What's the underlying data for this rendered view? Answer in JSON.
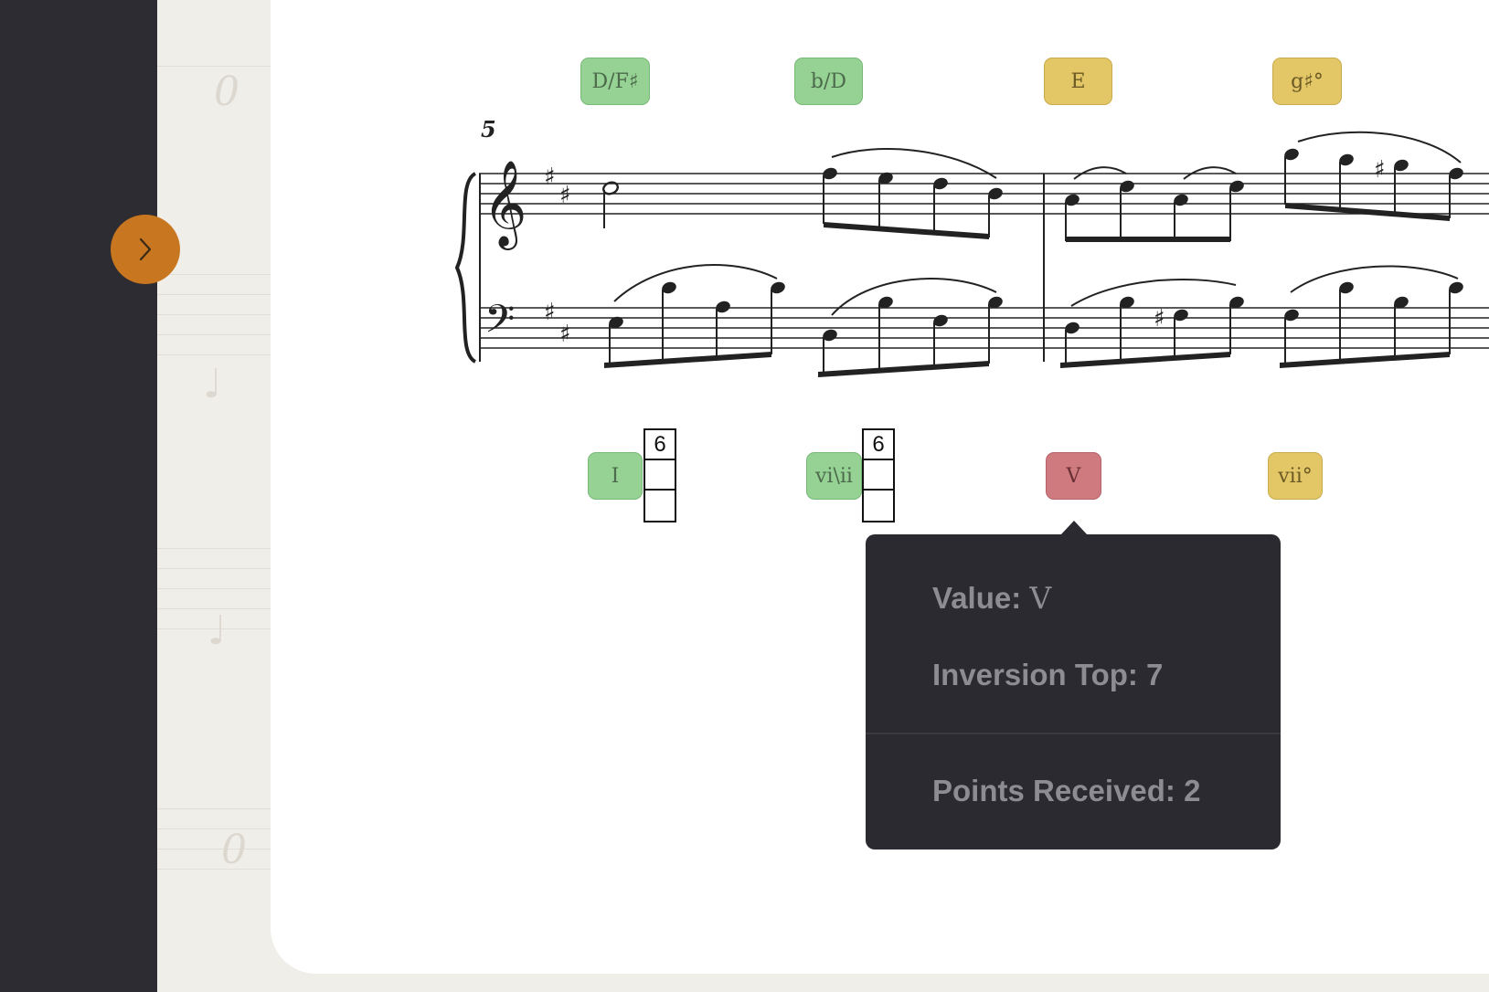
{
  "measure_number": "5",
  "chord_names": [
    {
      "label": "D/F♯",
      "status": "correct"
    },
    {
      "label": "b/D",
      "status": "correct"
    },
    {
      "label": "E",
      "status": "partial"
    },
    {
      "label": "g♯°",
      "status": "partial"
    }
  ],
  "roman_numerals": [
    {
      "label": "I",
      "status": "correct",
      "inversion": {
        "top": "6",
        "middle": "",
        "bottom": ""
      }
    },
    {
      "label": "vi\\ii",
      "status": "correct",
      "inversion": {
        "top": "6",
        "middle": "",
        "bottom": ""
      }
    },
    {
      "label": "V",
      "status": "incorrect"
    },
    {
      "label": "vii°",
      "status": "partial"
    }
  ],
  "tooltip": {
    "value_label": "Value:",
    "value": "V",
    "inversion_top": "Inversion Top: 7",
    "points_received": "Points Received: 2"
  },
  "colors": {
    "correct": "#95d293",
    "partial": "#e3c766",
    "incorrect": "#cf7a7f",
    "toggle": "#c87620",
    "sidebar": "#2d2c32"
  },
  "icons": {
    "toggle": "chevron-right-icon"
  }
}
